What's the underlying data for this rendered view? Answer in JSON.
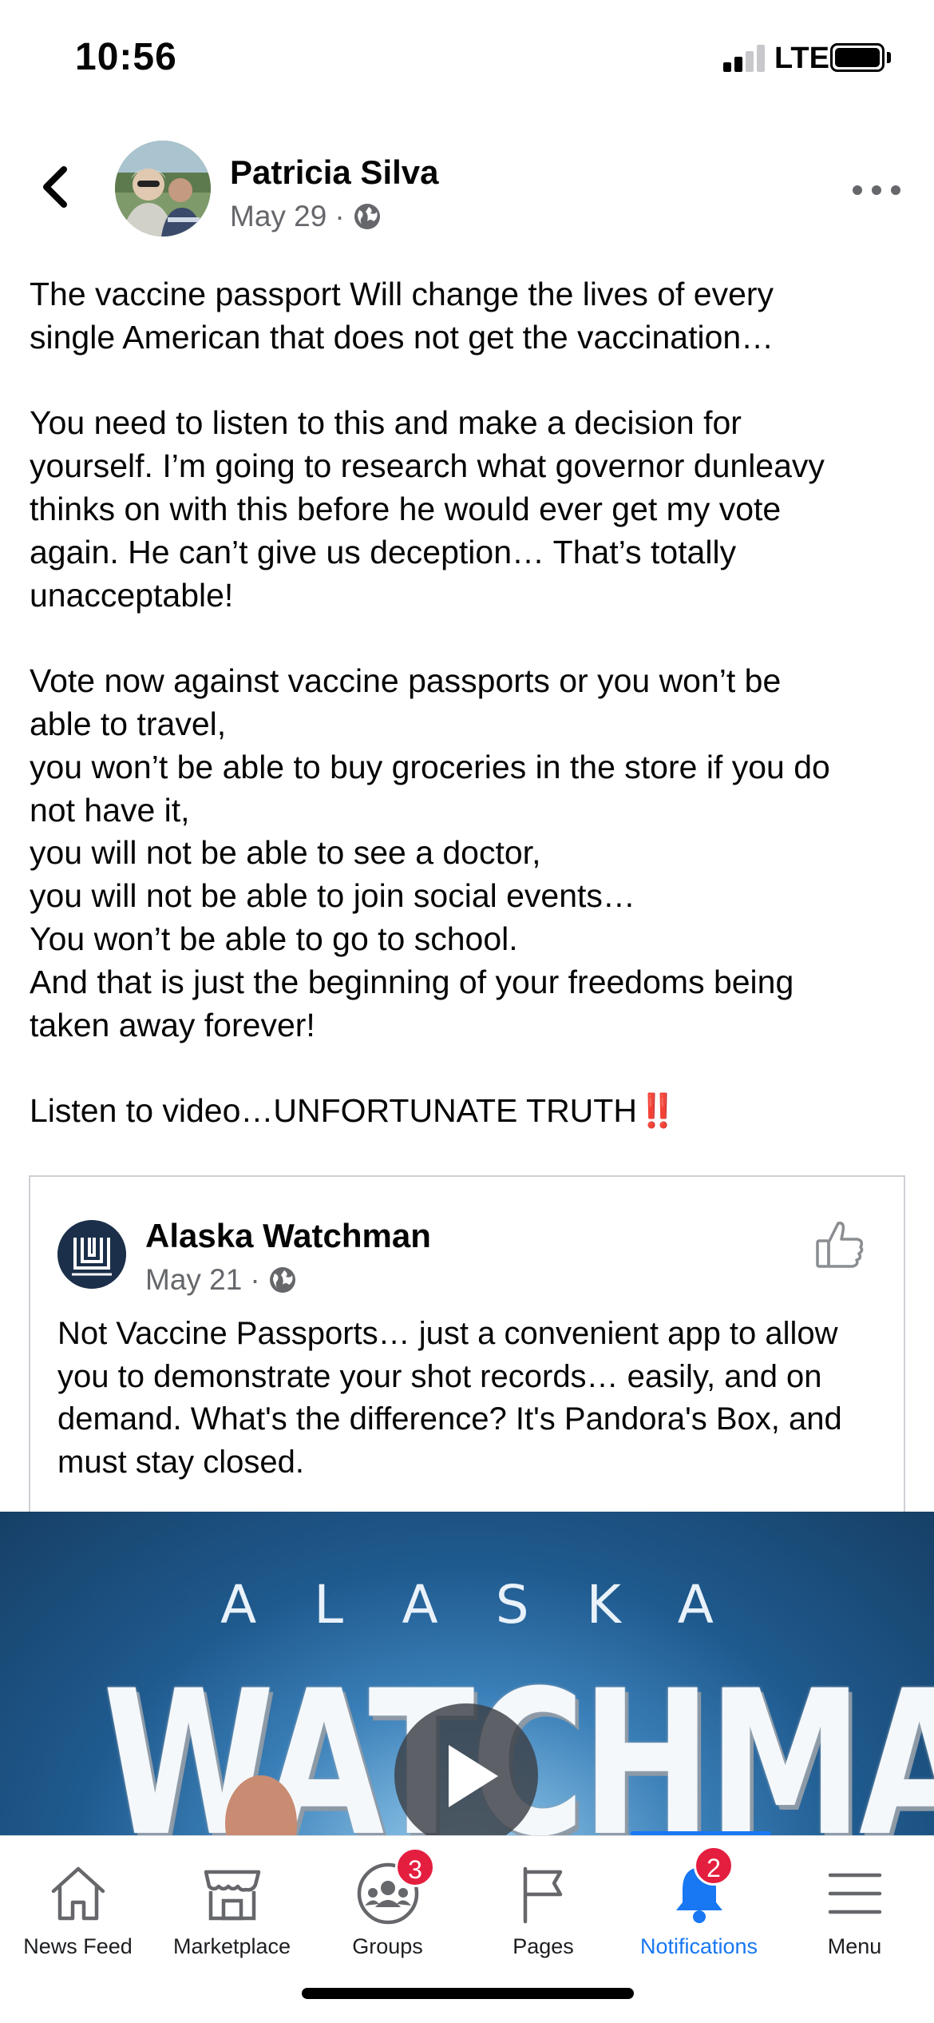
{
  "status_bar": {
    "time": "10:56",
    "network": "LTE"
  },
  "post": {
    "author": "Patricia Silva",
    "date": "May 29",
    "separator": "·",
    "text": "The vaccine passport Will change the lives of every\nsingle American that does not get the vaccination…\n\nYou need to listen to this and make a decision for\nyourself. I’m going to research what governor dunleavy\nthinks on with this before he would ever get my vote\nagain. He can’t give us deception… That’s totally\nunacceptable!\n\nVote now against vaccine passports or you won’t be\nable to travel,\nyou won’t be able to buy groceries in the store if you do\nnot have it,\nyou will not be able to see a doctor,\nyou will not be able to join social events…\nYou won’t be able to go to school.\nAnd that is just the beginning of your freedoms being\ntaken away forever!\n\nListen to video…UNFORTUNATE TRUTH‼️"
  },
  "shared_post": {
    "author": "Alaska Watchman",
    "date": "May 21",
    "separator": "·",
    "text": "Not Vaccine Passports… just a convenient app to allow you to demonstrate your shot records… easily, and on demand.  What's the difference?  It's Pandora's Box, and must stay closed."
  },
  "video": {
    "overline": "ALASKA",
    "title": "WATCHMAN"
  },
  "tab_bar": {
    "tabs": [
      {
        "label": "News Feed",
        "icon": "home-icon",
        "badge": null,
        "active": false
      },
      {
        "label": "Marketplace",
        "icon": "marketplace-icon",
        "badge": null,
        "active": false
      },
      {
        "label": "Groups",
        "icon": "groups-icon",
        "badge": "3",
        "active": false
      },
      {
        "label": "Pages",
        "icon": "flag-icon",
        "badge": null,
        "active": false
      },
      {
        "label": "Notifications",
        "icon": "bell-icon",
        "badge": "2",
        "active": true
      },
      {
        "label": "Menu",
        "icon": "menu-icon",
        "badge": null,
        "active": false
      }
    ],
    "accent_color": "#1877f2",
    "badge_color": "#e41e3f"
  }
}
